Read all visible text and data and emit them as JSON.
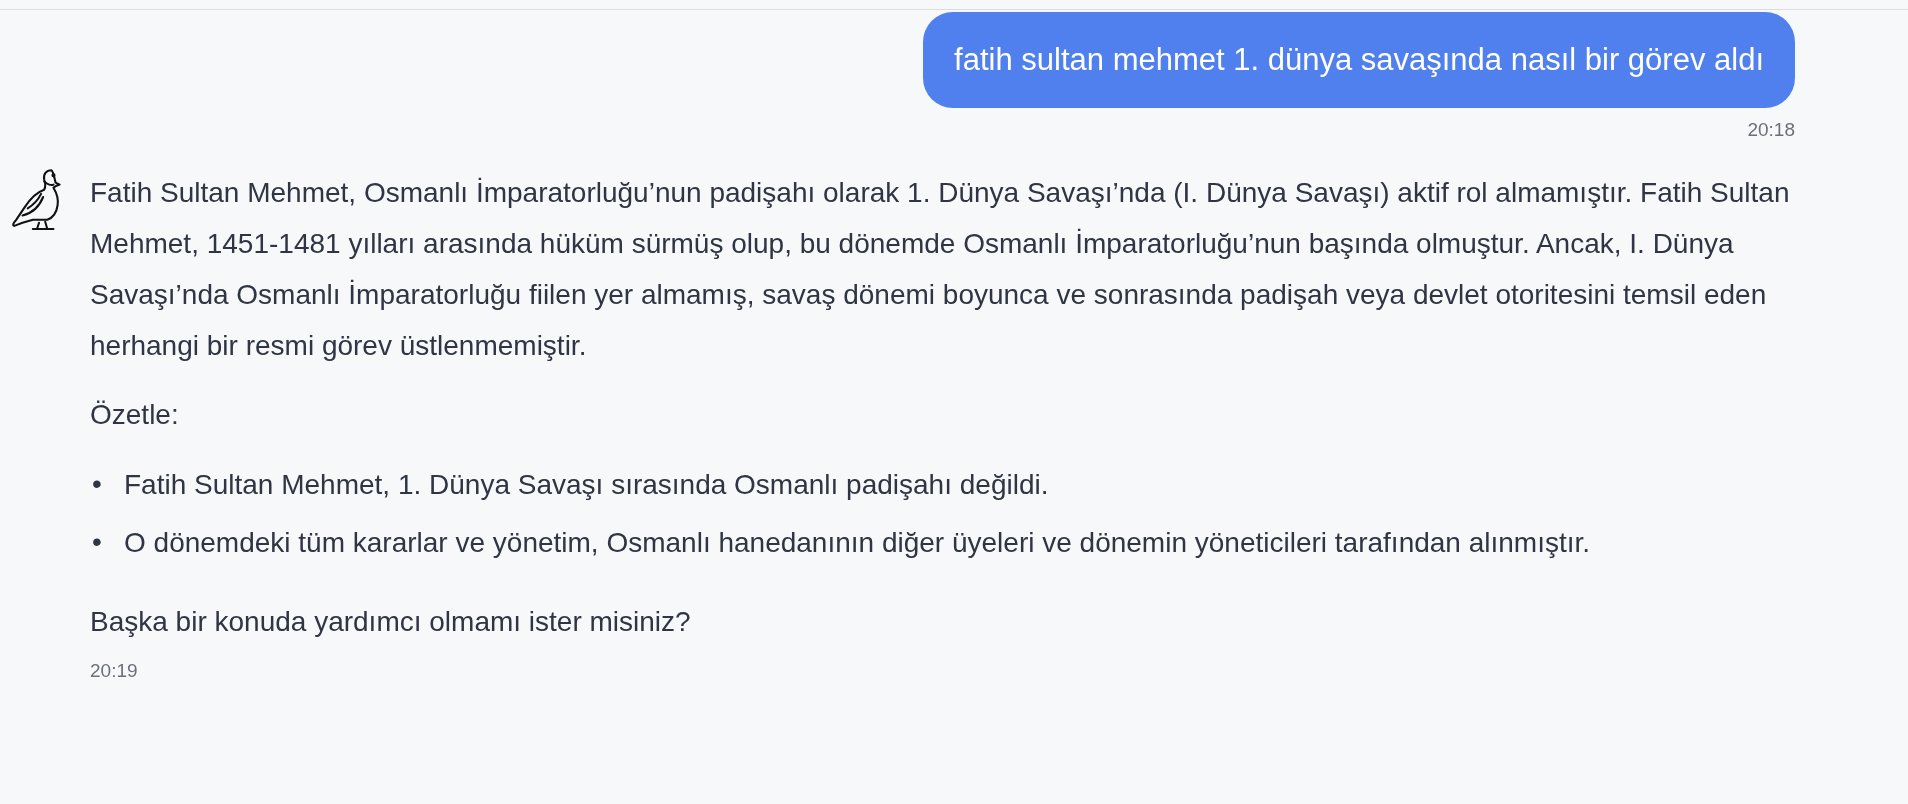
{
  "messages": [
    {
      "kind": "user",
      "text": "fatih sultan mehmet 1. dünya savaşında nasıl bir görev aldı",
      "time": "20:18"
    },
    {
      "kind": "assistant",
      "blocks": [
        {
          "kind": "paragraph",
          "text": "Fatih Sultan Mehmet, Osmanlı İmparatorluğu’nun padişahı olarak 1. Dünya Savaşı’nda (I. Dünya Savaşı) aktif rol almamıştır. Fatih Sultan Mehmet, 1451-1481 yılları arasında hüküm sürmüş olup, bu dönemde Osmanlı İmparatorluğu’nun başında olmuştur. Ancak, I. Dünya Savaşı’nda Osmanlı İmparatorluğu fiilen yer almamış, savaş dönemi boyunca ve sonrasında padişah veya devlet otoritesini temsil eden herhangi bir resmi görev üstlenmemiştir."
        },
        {
          "kind": "paragraph",
          "text": "Özetle:"
        },
        {
          "kind": "list",
          "items": [
            {
              "marker": "•",
              "text": "Fatih Sultan Mehmet, 1. Dünya Savaşı sırasında Osmanlı padişahı değildi."
            },
            {
              "marker": "•",
              "text": "O dönemdeki tüm kararlar ve yönetim, Osmanlı hanedanının diğer üyeleri ve dönemin yöneticileri tarafından alınmıştır."
            }
          ]
        },
        {
          "kind": "paragraph",
          "text": "Başka bir konuda yardımcı olmamı ister misiniz?"
        }
      ],
      "time": "20:19"
    }
  ]
}
